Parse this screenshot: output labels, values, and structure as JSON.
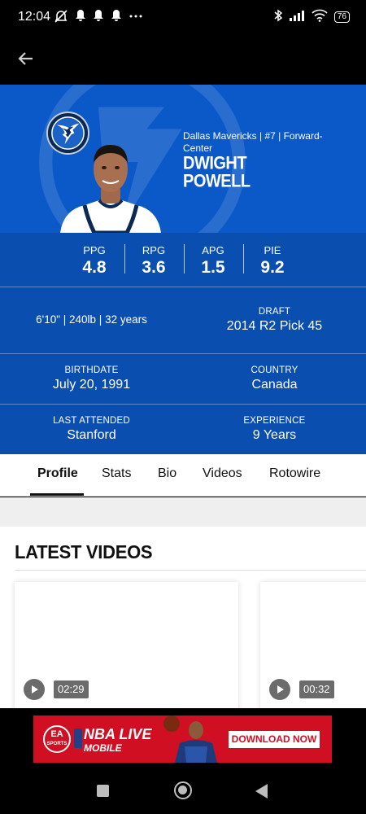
{
  "status_bar": {
    "time": "12:04",
    "battery": "76",
    "left_icons": [
      "muted-alarm-icon",
      "bell-icon",
      "bell-icon",
      "bell-icon",
      "more-dots-icon"
    ],
    "right_icons": [
      "bluetooth-icon",
      "signal-icon",
      "wifi-icon",
      "battery-icon"
    ]
  },
  "header": {
    "back_icon": "arrow-left-icon"
  },
  "player": {
    "team_line": "Dallas Mavericks | #7 | Forward-Center",
    "name_first": "DWIGHT",
    "name_last": "POWELL",
    "team_color": "#0b59c9"
  },
  "averages": [
    {
      "label": "PPG",
      "value": "4.8"
    },
    {
      "label": "RPG",
      "value": "3.6"
    },
    {
      "label": "APG",
      "value": "1.5"
    },
    {
      "label": "PIE",
      "value": "9.2"
    }
  ],
  "bio": {
    "measurements": "6'10\" | 240lb | 32 years",
    "draft_label": "DRAFT",
    "draft_value": "2014 R2 Pick 45",
    "birthdate_label": "BIRTHDATE",
    "birthdate_value": "July 20, 1991",
    "country_label": "COUNTRY",
    "country_value": "Canada",
    "attended_label": "LAST ATTENDED",
    "attended_value": "Stanford",
    "experience_label": "EXPERIENCE",
    "experience_value": "9 Years"
  },
  "tabs": [
    {
      "label": "Profile",
      "active": true
    },
    {
      "label": "Stats"
    },
    {
      "label": "Bio"
    },
    {
      "label": "Videos"
    },
    {
      "label": "Rotowire"
    }
  ],
  "latest_videos": {
    "title": "LATEST VIDEOS",
    "items": [
      {
        "duration": "02:29"
      },
      {
        "duration": "00:32"
      }
    ]
  },
  "ad": {
    "ea_label": "EA",
    "ea_sub": "SPORTS",
    "title": "NBA LIVE",
    "subtitle": "MOBILE",
    "cta": "DOWNLOAD NOW",
    "color": "#d10f22"
  }
}
